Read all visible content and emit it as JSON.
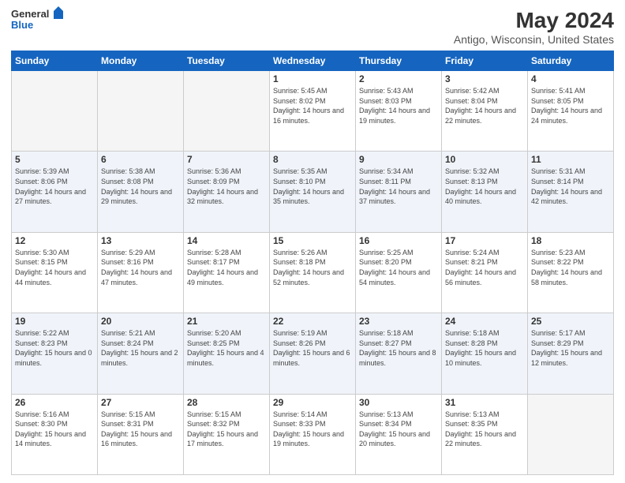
{
  "header": {
    "logo_line1": "General",
    "logo_line2": "Blue",
    "title": "May 2024",
    "location": "Antigo, Wisconsin, United States"
  },
  "calendar": {
    "days_of_week": [
      "Sunday",
      "Monday",
      "Tuesday",
      "Wednesday",
      "Thursday",
      "Friday",
      "Saturday"
    ],
    "weeks": [
      [
        {
          "day": "",
          "empty": true
        },
        {
          "day": "",
          "empty": true
        },
        {
          "day": "",
          "empty": true
        },
        {
          "day": "1",
          "sunrise": "5:45 AM",
          "sunset": "8:02 PM",
          "daylight": "14 hours and 16 minutes."
        },
        {
          "day": "2",
          "sunrise": "5:43 AM",
          "sunset": "8:03 PM",
          "daylight": "14 hours and 19 minutes."
        },
        {
          "day": "3",
          "sunrise": "5:42 AM",
          "sunset": "8:04 PM",
          "daylight": "14 hours and 22 minutes."
        },
        {
          "day": "4",
          "sunrise": "5:41 AM",
          "sunset": "8:05 PM",
          "daylight": "14 hours and 24 minutes."
        }
      ],
      [
        {
          "day": "5",
          "sunrise": "5:39 AM",
          "sunset": "8:06 PM",
          "daylight": "14 hours and 27 minutes."
        },
        {
          "day": "6",
          "sunrise": "5:38 AM",
          "sunset": "8:08 PM",
          "daylight": "14 hours and 29 minutes."
        },
        {
          "day": "7",
          "sunrise": "5:36 AM",
          "sunset": "8:09 PM",
          "daylight": "14 hours and 32 minutes."
        },
        {
          "day": "8",
          "sunrise": "5:35 AM",
          "sunset": "8:10 PM",
          "daylight": "14 hours and 35 minutes."
        },
        {
          "day": "9",
          "sunrise": "5:34 AM",
          "sunset": "8:11 PM",
          "daylight": "14 hours and 37 minutes."
        },
        {
          "day": "10",
          "sunrise": "5:32 AM",
          "sunset": "8:13 PM",
          "daylight": "14 hours and 40 minutes."
        },
        {
          "day": "11",
          "sunrise": "5:31 AM",
          "sunset": "8:14 PM",
          "daylight": "14 hours and 42 minutes."
        }
      ],
      [
        {
          "day": "12",
          "sunrise": "5:30 AM",
          "sunset": "8:15 PM",
          "daylight": "14 hours and 44 minutes."
        },
        {
          "day": "13",
          "sunrise": "5:29 AM",
          "sunset": "8:16 PM",
          "daylight": "14 hours and 47 minutes."
        },
        {
          "day": "14",
          "sunrise": "5:28 AM",
          "sunset": "8:17 PM",
          "daylight": "14 hours and 49 minutes."
        },
        {
          "day": "15",
          "sunrise": "5:26 AM",
          "sunset": "8:18 PM",
          "daylight": "14 hours and 52 minutes."
        },
        {
          "day": "16",
          "sunrise": "5:25 AM",
          "sunset": "8:20 PM",
          "daylight": "14 hours and 54 minutes."
        },
        {
          "day": "17",
          "sunrise": "5:24 AM",
          "sunset": "8:21 PM",
          "daylight": "14 hours and 56 minutes."
        },
        {
          "day": "18",
          "sunrise": "5:23 AM",
          "sunset": "8:22 PM",
          "daylight": "14 hours and 58 minutes."
        }
      ],
      [
        {
          "day": "19",
          "sunrise": "5:22 AM",
          "sunset": "8:23 PM",
          "daylight": "15 hours and 0 minutes."
        },
        {
          "day": "20",
          "sunrise": "5:21 AM",
          "sunset": "8:24 PM",
          "daylight": "15 hours and 2 minutes."
        },
        {
          "day": "21",
          "sunrise": "5:20 AM",
          "sunset": "8:25 PM",
          "daylight": "15 hours and 4 minutes."
        },
        {
          "day": "22",
          "sunrise": "5:19 AM",
          "sunset": "8:26 PM",
          "daylight": "15 hours and 6 minutes."
        },
        {
          "day": "23",
          "sunrise": "5:18 AM",
          "sunset": "8:27 PM",
          "daylight": "15 hours and 8 minutes."
        },
        {
          "day": "24",
          "sunrise": "5:18 AM",
          "sunset": "8:28 PM",
          "daylight": "15 hours and 10 minutes."
        },
        {
          "day": "25",
          "sunrise": "5:17 AM",
          "sunset": "8:29 PM",
          "daylight": "15 hours and 12 minutes."
        }
      ],
      [
        {
          "day": "26",
          "sunrise": "5:16 AM",
          "sunset": "8:30 PM",
          "daylight": "15 hours and 14 minutes."
        },
        {
          "day": "27",
          "sunrise": "5:15 AM",
          "sunset": "8:31 PM",
          "daylight": "15 hours and 16 minutes."
        },
        {
          "day": "28",
          "sunrise": "5:15 AM",
          "sunset": "8:32 PM",
          "daylight": "15 hours and 17 minutes."
        },
        {
          "day": "29",
          "sunrise": "5:14 AM",
          "sunset": "8:33 PM",
          "daylight": "15 hours and 19 minutes."
        },
        {
          "day": "30",
          "sunrise": "5:13 AM",
          "sunset": "8:34 PM",
          "daylight": "15 hours and 20 minutes."
        },
        {
          "day": "31",
          "sunrise": "5:13 AM",
          "sunset": "8:35 PM",
          "daylight": "15 hours and 22 minutes."
        },
        {
          "day": "",
          "empty": true
        }
      ]
    ]
  }
}
